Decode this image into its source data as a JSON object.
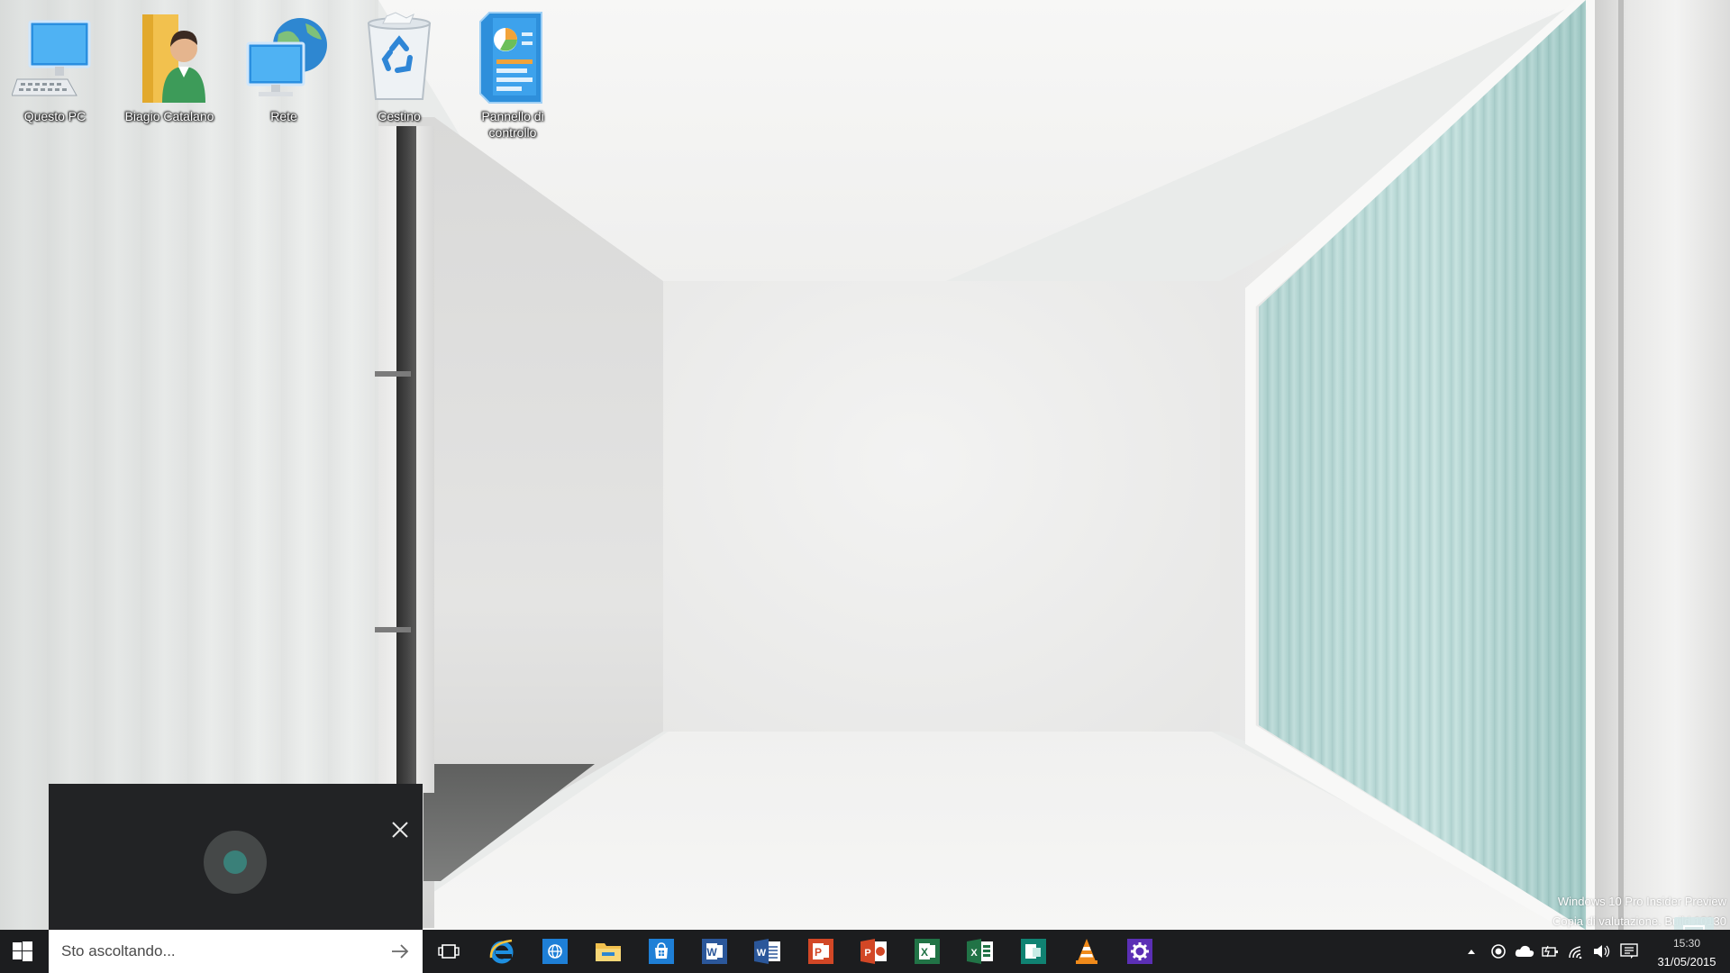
{
  "desktop": {
    "icons": [
      {
        "label": "Questo PC",
        "icon": "computer-icon"
      },
      {
        "label": "Biagio Catalano",
        "icon": "user-folder-icon"
      },
      {
        "label": "Rete",
        "icon": "network-icon"
      },
      {
        "label": "Cestino",
        "icon": "recycle-bin-icon"
      },
      {
        "label": "Pannello di controllo",
        "icon": "control-panel-icon"
      }
    ]
  },
  "cortana": {
    "search_placeholder": "Sto ascoltando..."
  },
  "taskbar": {
    "pinned": [
      {
        "name": "task-view",
        "icon": "task-view-icon"
      },
      {
        "name": "internet-explorer",
        "icon": "internet-explorer-icon"
      },
      {
        "name": "browser",
        "icon": "globe-app-icon"
      },
      {
        "name": "file-explorer",
        "icon": "folder-icon"
      },
      {
        "name": "store",
        "icon": "store-icon"
      },
      {
        "name": "word-mobile",
        "icon": "word-mobile-icon"
      },
      {
        "name": "word",
        "icon": "word-icon"
      },
      {
        "name": "powerpoint-mobile",
        "icon": "powerpoint-mobile-icon"
      },
      {
        "name": "powerpoint",
        "icon": "powerpoint-icon"
      },
      {
        "name": "excel-mobile",
        "icon": "excel-mobile-icon"
      },
      {
        "name": "excel",
        "icon": "excel-icon"
      },
      {
        "name": "sway",
        "icon": "sway-icon"
      },
      {
        "name": "vlc",
        "icon": "vlc-cone-icon"
      },
      {
        "name": "settings",
        "icon": "gear-icon"
      }
    ],
    "clock": {
      "time": "15:30",
      "date": "31/05/2015"
    }
  },
  "watermark": {
    "line1": "Windows 10 Pro Insider Preview",
    "line2": "Copia di valutazione. Build 10130"
  },
  "colors": {
    "taskbar": "#1c1d1f",
    "cortana_panel": "#222325",
    "cortana_dot": "#3a8079",
    "office_word": "#2b579a",
    "office_powerpoint": "#d24726",
    "office_excel": "#217346",
    "accent_blue": "#1e7fd6"
  }
}
